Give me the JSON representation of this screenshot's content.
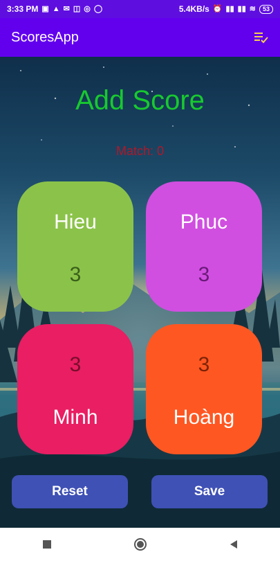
{
  "status_bar": {
    "time": "3:33 PM",
    "network_speed": "5.4KB/s",
    "battery": "53"
  },
  "app_bar": {
    "title": "ScoresApp",
    "menu_icon": "playlist-check-icon"
  },
  "main": {
    "heading": "Add Score",
    "match_label": "Match: 0",
    "players": [
      {
        "name": "Hieu",
        "score": "3",
        "color": "#8bc34a"
      },
      {
        "name": "Phuc",
        "score": "3",
        "color": "#d04fe0"
      },
      {
        "name": "Minh",
        "score": "3",
        "color": "#e91e63"
      },
      {
        "name": "Hoàng",
        "score": "3",
        "color": "#ff5722"
      }
    ],
    "accent_color": "#18c92f"
  },
  "buttons": {
    "reset": "Reset",
    "save": "Save",
    "color": "#3f51b5"
  },
  "nav_bar": {
    "items": [
      "recent-apps-icon",
      "home-icon",
      "back-icon"
    ]
  }
}
